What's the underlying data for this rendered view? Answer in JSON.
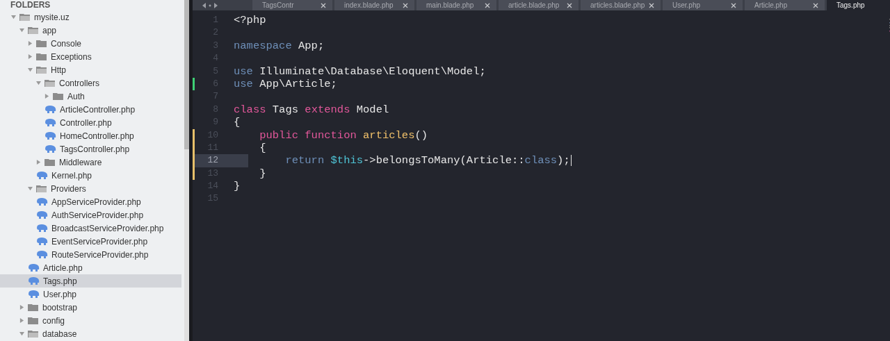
{
  "sidebar": {
    "heading": "FOLDERS",
    "tree": [
      {
        "label": "mysite.uz",
        "kind": "folder",
        "expanded": true,
        "selected": false,
        "children": [
          {
            "label": "app",
            "kind": "folder",
            "expanded": true,
            "selected": false,
            "children": [
              {
                "label": "Console",
                "kind": "folder",
                "expanded": false,
                "selected": false
              },
              {
                "label": "Exceptions",
                "kind": "folder",
                "expanded": false,
                "selected": false
              },
              {
                "label": "Http",
                "kind": "folder",
                "expanded": true,
                "selected": false,
                "children": [
                  {
                    "label": "Controllers",
                    "kind": "folder",
                    "expanded": true,
                    "selected": false,
                    "children": [
                      {
                        "label": "Auth",
                        "kind": "folder",
                        "expanded": false,
                        "selected": false
                      },
                      {
                        "label": "ArticleController.php",
                        "kind": "file",
                        "selected": false
                      },
                      {
                        "label": "Controller.php",
                        "kind": "file",
                        "selected": false
                      },
                      {
                        "label": "HomeController.php",
                        "kind": "file",
                        "selected": false
                      },
                      {
                        "label": "TagsController.php",
                        "kind": "file",
                        "selected": false
                      }
                    ]
                  },
                  {
                    "label": "Middleware",
                    "kind": "folder",
                    "expanded": false,
                    "selected": false
                  },
                  {
                    "label": "Kernel.php",
                    "kind": "file",
                    "selected": false
                  }
                ]
              },
              {
                "label": "Providers",
                "kind": "folder",
                "expanded": true,
                "selected": false,
                "children": [
                  {
                    "label": "AppServiceProvider.php",
                    "kind": "file",
                    "selected": false
                  },
                  {
                    "label": "AuthServiceProvider.php",
                    "kind": "file",
                    "selected": false
                  },
                  {
                    "label": "BroadcastServiceProvider.php",
                    "kind": "file",
                    "selected": false
                  },
                  {
                    "label": "EventServiceProvider.php",
                    "kind": "file",
                    "selected": false
                  },
                  {
                    "label": "RouteServiceProvider.php",
                    "kind": "file",
                    "selected": false
                  }
                ]
              },
              {
                "label": "Article.php",
                "kind": "file",
                "selected": false
              },
              {
                "label": "Tags.php",
                "kind": "file",
                "selected": true
              },
              {
                "label": "User.php",
                "kind": "file",
                "selected": false
              }
            ]
          },
          {
            "label": "bootstrap",
            "kind": "folder",
            "expanded": false,
            "selected": false
          },
          {
            "label": "config",
            "kind": "folder",
            "expanded": false,
            "selected": false
          },
          {
            "label": "database",
            "kind": "folder",
            "expanded": true,
            "selected": false
          }
        ]
      }
    ]
  },
  "tabs": [
    {
      "label": "TagsContr",
      "selected": false
    },
    {
      "label": "index.blade.php",
      "selected": false
    },
    {
      "label": "main.blade.php",
      "selected": false
    },
    {
      "label": "article.blade.php",
      "selected": false
    },
    {
      "label": "articles.blade.php",
      "selected": false
    },
    {
      "label": "User.php",
      "selected": false
    },
    {
      "label": "Article.php",
      "selected": false
    },
    {
      "label": "Tags.php",
      "selected": true
    }
  ],
  "editor": {
    "lines": [
      {
        "number": "1",
        "current": false,
        "tokens": [
          {
            "kind": "plain",
            "text": "<?php"
          }
        ]
      },
      {
        "number": "2",
        "current": false
      },
      {
        "number": "3",
        "current": false,
        "tokens": [
          {
            "kind": "storage",
            "text": "namespace"
          },
          {
            "kind": "plain",
            "text": " App;"
          }
        ]
      },
      {
        "number": "4",
        "current": false
      },
      {
        "number": "5",
        "current": false,
        "tokens": [
          {
            "kind": "storage",
            "text": "use"
          },
          {
            "kind": "plain",
            "text": " Illuminate\\Database\\Eloquent\\Model;"
          }
        ]
      },
      {
        "number": "6",
        "color": "#3ed175",
        "current": false,
        "tokens": [
          {
            "kind": "storage",
            "text": "use"
          },
          {
            "kind": "plain",
            "text": " App\\Article;"
          }
        ]
      },
      {
        "number": "7",
        "current": false
      },
      {
        "number": "8",
        "current": false,
        "tokens": [
          {
            "kind": "keyword",
            "text": "class"
          },
          {
            "kind": "plain",
            "text": " Tags "
          },
          {
            "kind": "keyword",
            "text": "extends"
          },
          {
            "kind": "plain",
            "text": " Model"
          }
        ]
      },
      {
        "number": "9",
        "current": false,
        "tokens": [
          {
            "kind": "plain",
            "text": "{"
          }
        ]
      },
      {
        "number": "10",
        "color": "#e7c06a",
        "current": false,
        "tokens": [
          {
            "kind": "keyword",
            "text": "    public"
          },
          {
            "kind": "keyword",
            "text": " function"
          },
          {
            "kind": "function",
            "text": " articles"
          },
          {
            "kind": "plain",
            "text": "()"
          }
        ]
      },
      {
        "number": "11",
        "color": "#e7c06a",
        "current": false,
        "tokens": [
          {
            "kind": "plain",
            "text": "    {"
          }
        ]
      },
      {
        "number": "12",
        "color": "#e7c06a",
        "current": true,
        "tokens": [
          {
            "kind": "storage",
            "text": "        return"
          },
          {
            "kind": "variable",
            "text": " $this"
          },
          {
            "kind": "plain",
            "text": "->belongsToMany(Article::"
          },
          {
            "kind": "constant",
            "text": "class"
          },
          {
            "kind": "plain",
            "text": ");"
          }
        ]
      },
      {
        "number": "13",
        "color": "#e7c06a",
        "current": false,
        "tokens": [
          {
            "kind": "plain",
            "text": "    }"
          }
        ]
      },
      {
        "number": "14",
        "current": false,
        "tokens": [
          {
            "kind": "plain",
            "text": "}"
          }
        ]
      },
      {
        "number": "15",
        "current": false
      }
    ]
  }
}
